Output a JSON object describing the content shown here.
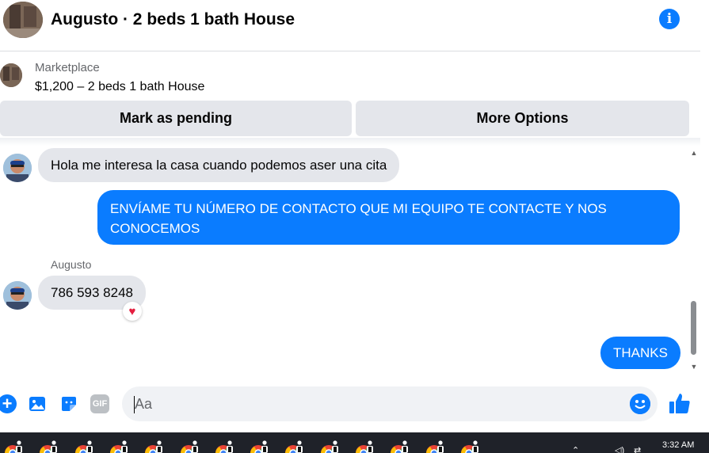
{
  "header": {
    "title": "Augusto · 2 beds 1 bath House"
  },
  "marketplace": {
    "label": "Marketplace",
    "item": "$1,200 – 2 beds 1 bath House",
    "mark_pending_label": "Mark as pending",
    "more_options_label": "More Options"
  },
  "messages": [
    {
      "direction": "incoming",
      "text": "Hola me interesa la casa cuando podemos aser una cita"
    },
    {
      "direction": "outgoing",
      "text": "ENVÍAME TU NÚMERO DE CONTACTO QUE MI EQUIPO TE CONTACTE Y NOS CONOCEMOS"
    },
    {
      "direction": "incoming",
      "sender": "Augusto",
      "text": "786 593 8248",
      "reaction": "heart"
    },
    {
      "direction": "outgoing",
      "text": "THANKS"
    }
  ],
  "composer": {
    "placeholder": "Aa"
  },
  "icons": {
    "header": [
      "info-icon"
    ],
    "composer": [
      "plus-icon",
      "image-icon",
      "sticker-icon",
      "gif-icon",
      "emoji-icon",
      "like-icon"
    ]
  },
  "gif_label": "GIF",
  "taskbar": {
    "time": "3:32 AM",
    "app_count": 14
  },
  "colors": {
    "accent": "#0a7cff",
    "bubble_incoming": "#e4e6eb",
    "button_bg": "#e4e6eb",
    "taskbar": "#1f2229"
  }
}
